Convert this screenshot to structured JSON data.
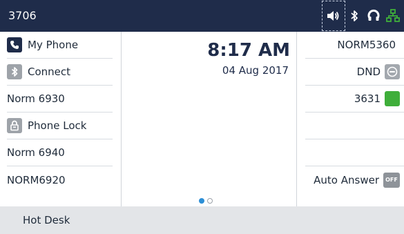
{
  "header": {
    "extension": "3706",
    "icons": [
      "speaker-icon",
      "bluetooth-icon",
      "headset-icon",
      "network-icon"
    ]
  },
  "clock": {
    "time": "8:17 AM",
    "date": "04 Aug 2017"
  },
  "left_keys": [
    {
      "label": "My Phone",
      "icon": "phone-icon"
    },
    {
      "label": "Connect",
      "icon": "bluetooth-icon"
    },
    {
      "label": "Norm 6930",
      "icon": ""
    },
    {
      "label": "Phone Lock",
      "icon": "lock-icon"
    },
    {
      "label": "Norm 6940",
      "icon": ""
    },
    {
      "label": "NORM6920",
      "icon": ""
    }
  ],
  "right_keys": [
    {
      "label": "NORM5360",
      "status": ""
    },
    {
      "label": "DND",
      "status": "dnd-icon"
    },
    {
      "label": "3631",
      "status": "available"
    },
    {
      "label": "",
      "status": ""
    },
    {
      "label": "",
      "status": ""
    },
    {
      "label": "Auto Answer",
      "status": "off",
      "badge": "OFF"
    }
  ],
  "pagination": {
    "current": 1,
    "total": 2
  },
  "softkeys": [
    {
      "label": "Hot Desk"
    }
  ],
  "colors": {
    "header_bg": "#1f2c4a",
    "softkey_bg": "#e3e5e8",
    "status_green": "#3fae3a",
    "page_dot_active": "#2d8fd6",
    "network_green": "#3fae3a"
  }
}
